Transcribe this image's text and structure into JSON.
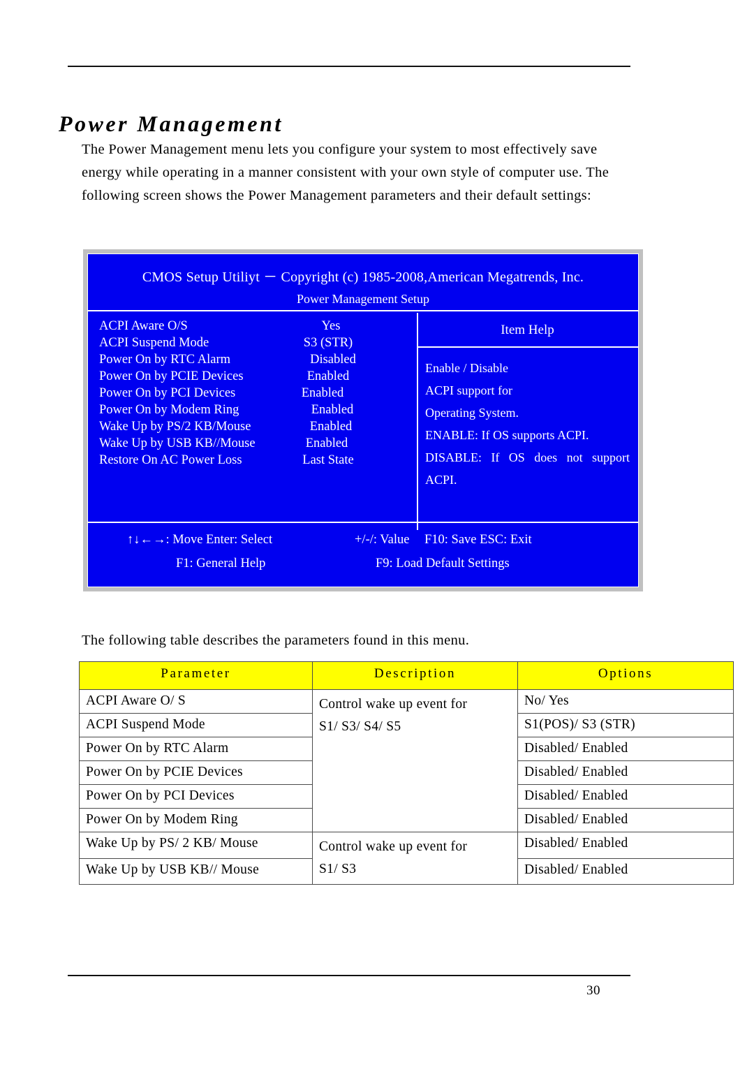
{
  "page": {
    "number": "30",
    "chapter_title": "Power Management",
    "intro": "The Power Management menu lets you configure your system to most effectively save energy while operating in a manner consistent with your own style of computer use. The following screen shows the Power Management parameters and their default settings:",
    "after_note": "The following table describes the parameters found in this menu."
  },
  "colors": {
    "bios_background": "#0000f0",
    "bios_frame": "#c0c0c0",
    "bios_text": "#ffffff",
    "table_header_background": "#ffff00",
    "table_border": "#4a4a4a",
    "page_text": "#000000"
  },
  "bios": {
    "title_line1": "CMOS Setup Utiliyt － Copyright (c) 1985-2008,American Megatrends, Inc.",
    "title_line2": "Power Management Setup",
    "settings": [
      {
        "label": "ACPI Aware O/S",
        "value": "Yes"
      },
      {
        "label": "ACPI Suspend Mode",
        "value": "S3 (STR)"
      },
      {
        "label": "Power On by RTC Alarm",
        "value": "Disabled"
      },
      {
        "label": "Power On by PCIE Devices",
        "value": "Enabled"
      },
      {
        "label": "Power On by PCI Devices",
        "value": "Enabled"
      },
      {
        "label": "Power On by Modem Ring",
        "value": "Enabled"
      },
      {
        "label": "Wake Up by PS/2 KB/Mouse",
        "value": "Enabled"
      },
      {
        "label": "Wake Up by USB KB//Mouse",
        "value": "Enabled"
      },
      {
        "label": "Restore On AC Power Loss",
        "value": "Last State"
      }
    ],
    "help": {
      "title": "Item Help",
      "lines": [
        "Enable / Disable",
        "ACPI support for",
        "Operating System.",
        "ENABLE: If OS supports ACPI.",
        "DISABLE: If OS does not support",
        "ACPI."
      ]
    },
    "footer": {
      "move_keys": "↑↓←→: Move Enter: Select",
      "value_keys": "+/-/: Value",
      "save_exit_keys": "F10: Save ESC: Exit",
      "general_help": "F1: General Help",
      "load_defaults": "F9: Load Default Settings"
    }
  },
  "parameter_table": {
    "headers": [
      "Parameter",
      "Description",
      "Options"
    ],
    "rows": [
      {
        "parameter": "ACPI Aware O/ S",
        "options": "No/ Yes"
      },
      {
        "parameter": "ACPI Suspend Mode",
        "options": "S1(POS)/ S3 (STR)"
      },
      {
        "parameter": "Power On by RTC Alarm",
        "options": "Disabled/ Enabled"
      },
      {
        "parameter": "Power On by PCIE Devices",
        "options": "Disabled/ Enabled"
      },
      {
        "parameter": "Power On by PCI Devices",
        "options": "Disabled/ Enabled"
      },
      {
        "parameter": "Power On by Modem Ring",
        "options": "Disabled/ Enabled"
      },
      {
        "parameter": "Wake Up by PS/ 2 KB/ Mouse",
        "options": "Disabled/ Enabled"
      },
      {
        "parameter": "Wake Up by USB KB// Mouse",
        "options": "Disabled/ Enabled"
      }
    ],
    "descriptions": [
      {
        "text_line1": "Control wake up event for",
        "text_line2": "S1/ S3/ S4/ S5",
        "rowspan": 6
      },
      {
        "text_line1": "Control wake up event for",
        "text_line2": "S1/ S3",
        "rowspan": 2
      }
    ]
  }
}
